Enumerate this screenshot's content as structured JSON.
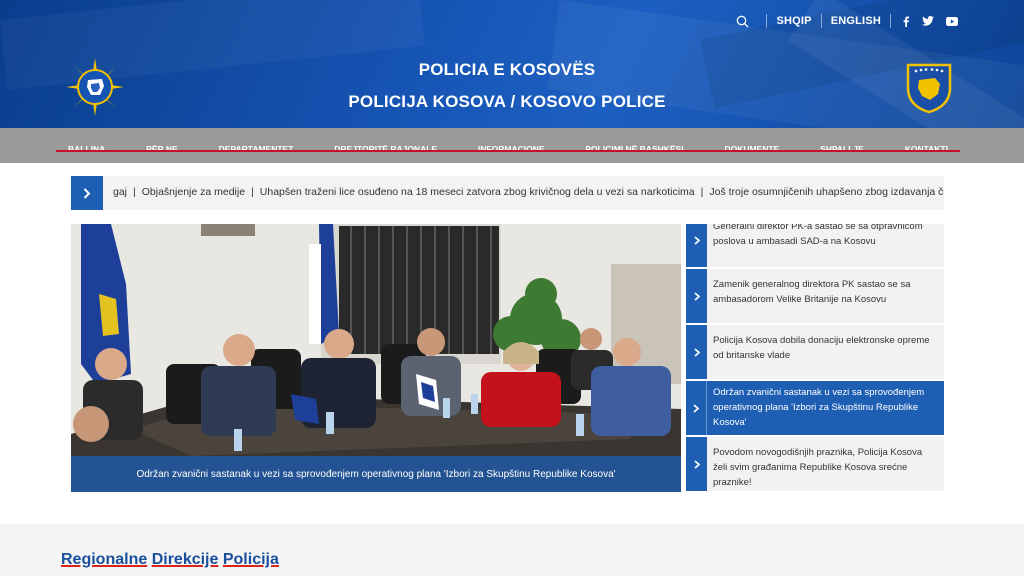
{
  "header": {
    "title_line1": "POLICIA E KOSOVËS",
    "title_line2": "POLICIJA KOSOVA / KOSOVO POLICE",
    "lang_sq": "SHQIP",
    "lang_en": "ENGLISH",
    "logo_text": "KOSOVO",
    "logo_subtext": "POLICE",
    "social": [
      "facebook-icon",
      "twitter-icon",
      "youtube-icon"
    ]
  },
  "nav": {
    "items": [
      "BALLINA",
      "PËR NE",
      "DEPARTAMENTET",
      "DREJTORITË RAJONALE",
      "INFORMACIONE",
      "POLICIMI NË BASHKËSI",
      "DOKUMENTE",
      "SHPALLJE",
      "KONTAKTI"
    ]
  },
  "ticker": {
    "items": [
      "gaj",
      "Objašnjenje za medije",
      "Uhapšen traženi lice osuđeno na 18 meseci zatvora zbog krivičnog dela u vezi sa narkoticima",
      "Još troje osumnjičenih uhapšeno zbog izdavanja čekove"
    ]
  },
  "hero": {
    "caption": "Održan zvanični sastanak u vezi sa sprovođenjem operativnog plana 'Izbori za Skupštinu Republike Kosova'"
  },
  "side_news": [
    "Generalni direktor PK-a sastao se sa otpravnicom poslova u ambasadi SAD-a na Kosovu",
    "Zamenik generalnog direktora PK sastao se sa ambasadorom Velike Britanije na Kosovu",
    "Policija Kosova dobila donaciju elektronske opreme od britanske vlade",
    "Održan zvanični sastanak u vezi sa sprovođenjem operativnog plana 'Izbori za Skupštinu Republike Kosova'",
    "Povodom novogodišnjih praznika, Policija Kosova želi svim građanima Republike Kosova srećne praznike!"
  ],
  "section": {
    "word1": "Regionalne",
    "word2": "Direkcije",
    "word3": "Policija"
  },
  "colors": {
    "header_blue": "#1654b3",
    "nav_gray": "#9a9a9a",
    "accent_red": "#c8102e",
    "button_blue": "#1e5fb4"
  }
}
